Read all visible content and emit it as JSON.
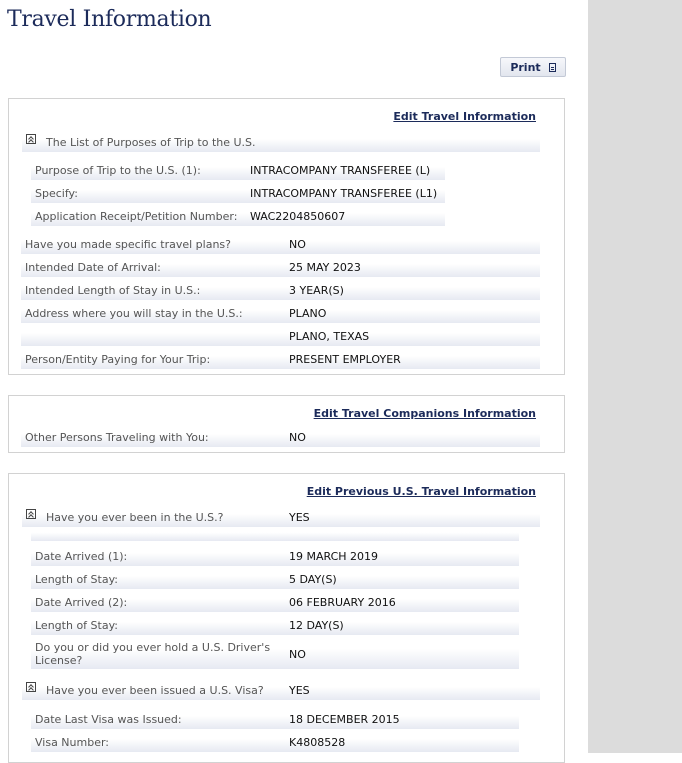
{
  "page": {
    "title": "Travel Information",
    "print_label": "Print"
  },
  "travel": {
    "edit_label": "Edit Travel Information",
    "purposes_header": "The List of Purposes of Trip to the U.S.",
    "purpose_rows": [
      {
        "label": "Purpose of Trip to the U.S. (1):",
        "value": "INTRACOMPANY TRANSFEREE (L)"
      },
      {
        "label": "Specify:",
        "value": "INTRACOMPANY TRANSFEREE (L1)"
      },
      {
        "label": "Application Receipt/Petition Number:",
        "value": "WAC2204850607"
      }
    ],
    "rows": [
      {
        "label": "Have you made specific travel plans?",
        "value": "NO"
      },
      {
        "label": "Intended Date of Arrival:",
        "value": "25 MAY 2023"
      },
      {
        "label": "Intended Length of Stay in U.S.:",
        "value": "3 YEAR(S)"
      },
      {
        "label": "Address where you will stay in the U.S.:",
        "value": "PLANO"
      },
      {
        "label": "",
        "value": "PLANO, TEXAS"
      },
      {
        "label": "Person/Entity Paying for Your Trip:",
        "value": "PRESENT EMPLOYER"
      }
    ]
  },
  "companions": {
    "edit_label": "Edit Travel Companions Information",
    "rows": [
      {
        "label": "Other Persons Traveling with You:",
        "value": "NO"
      }
    ]
  },
  "previous": {
    "edit_label": "Edit Previous U.S. Travel Information",
    "been_in_us": {
      "label": "Have you ever been in the U.S.?",
      "value": "YES"
    },
    "visit_rows": [
      {
        "label": "Date Arrived (1):",
        "value": "19 MARCH 2019"
      },
      {
        "label": "Length of Stay:",
        "value": "5 DAY(S)"
      },
      {
        "label": "Date Arrived (2):",
        "value": "06 FEBRUARY 2016"
      },
      {
        "label": "Length of Stay:",
        "value": "12 DAY(S)"
      }
    ],
    "drivers_license": {
      "label_line1": "Do you or did you ever hold a U.S. Driver's",
      "label_line2": "License?",
      "value": "NO"
    },
    "visa_issued": {
      "label": "Have you ever been issued a U.S. Visa?",
      "value": "YES"
    },
    "visa_rows": [
      {
        "label": "Date Last Visa was Issued:",
        "value": "18 DECEMBER 2015"
      },
      {
        "label": "Visa Number:",
        "value": "K4808528"
      }
    ]
  }
}
